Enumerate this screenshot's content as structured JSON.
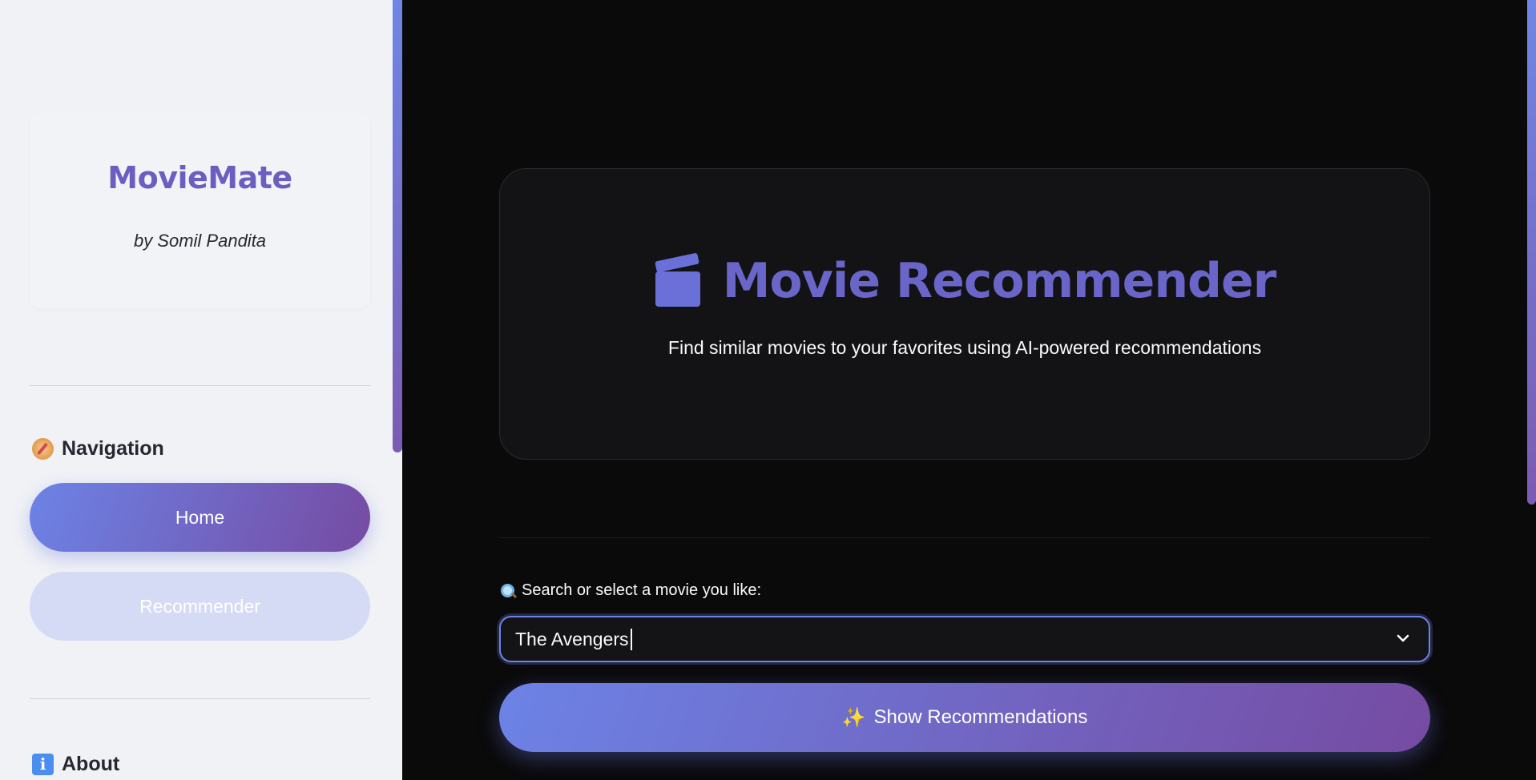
{
  "sidebar": {
    "brand_title": "MovieMate",
    "brand_subtitle": "by Somil Pandita",
    "navigation_heading": "Navigation",
    "nav_items": [
      {
        "label": "Home",
        "active": true
      },
      {
        "label": "Recommender",
        "active": false
      }
    ],
    "about_heading": "About"
  },
  "hero": {
    "title": "Movie Recommender",
    "subtitle": "Find similar movies to your favorites using AI-powered recommendations"
  },
  "search": {
    "label": "Search or select a movie you like:",
    "selected_value": "The Avengers"
  },
  "actions": {
    "show_recommendations": "Show Recommendations"
  },
  "icons": {
    "navigation": "compass-icon",
    "about": "info-icon",
    "hero": "clapper-board-icon",
    "search": "magnifier-icon",
    "dropdown": "chevron-down-icon",
    "button": "sparkles-icon"
  },
  "colors": {
    "accent_start": "#6c83e6",
    "accent_end": "#764ba2",
    "main_background": "#0a0a0b",
    "sidebar_background": "#f0f2f6"
  }
}
